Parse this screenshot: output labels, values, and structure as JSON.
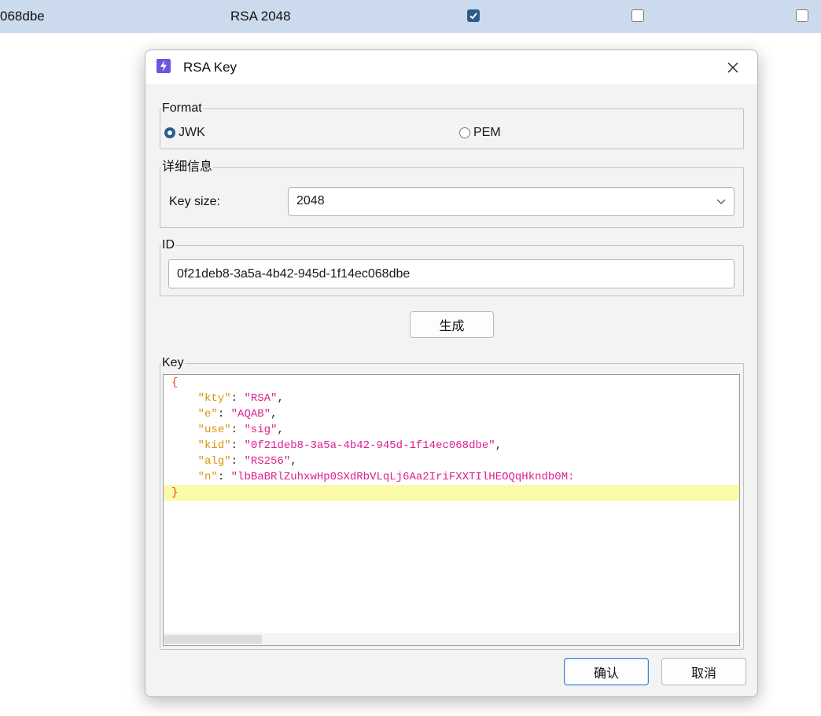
{
  "background_row": {
    "id_suffix": "068dbe",
    "algorithm": "RSA 2048",
    "checkbox_1_checked": true,
    "checkbox_2_checked": false,
    "checkbox_3_checked": false
  },
  "dialog": {
    "title": "RSA Key",
    "format": {
      "legend": "Format",
      "option_jwk": "JWK",
      "option_pem": "PEM",
      "selected": "JWK"
    },
    "details": {
      "legend": "详细信息",
      "key_size_label": "Key size:",
      "key_size_value": "2048"
    },
    "id_group": {
      "legend": "ID",
      "value": "0f21deb8-3a5a-4b42-945d-1f14ec068dbe"
    },
    "generate_button": "生成",
    "key_group": {
      "legend": "Key",
      "open_brace": "{",
      "close_brace": "}",
      "entries": [
        {
          "key": "\"kty\"",
          "value": "\"RSA\"",
          "trail": ","
        },
        {
          "key": "\"e\"",
          "value": "\"AQAB\"",
          "trail": ","
        },
        {
          "key": "\"use\"",
          "value": "\"sig\"",
          "trail": ","
        },
        {
          "key": "\"kid\"",
          "value": "\"0f21deb8-3a5a-4b42-945d-1f14ec068dbe\"",
          "trail": ","
        },
        {
          "key": "\"alg\"",
          "value": "\"RS256\"",
          "trail": ","
        },
        {
          "key": "\"n\"",
          "value": "\"lbBaBRlZuhxwHp0SXdRbVLqLj6Aa2IriFXXTIlHEOQqHkndb0M:",
          "trail": ""
        }
      ]
    },
    "ok_button": "确认",
    "cancel_button": "取消"
  },
  "colors": {
    "row_selected_bg": "#ccdaee",
    "accent": "#2a5d8e",
    "json_brace": "#e8402a",
    "json_key": "#d9950a",
    "json_string": "#d9208c",
    "current_line_highlight": "#fafaa8"
  },
  "icons": {
    "app": "lightning-icon",
    "close": "close-icon",
    "dropdown": "chevron-down-icon",
    "checkbox": "checkmark-icon"
  }
}
